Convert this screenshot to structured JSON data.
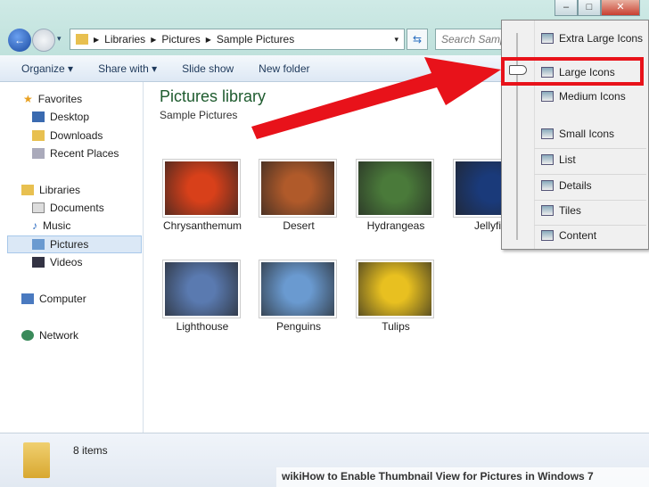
{
  "address": {
    "crumbs": [
      "Libraries",
      "Pictures",
      "Sample Pictures"
    ],
    "search_placeholder": "Search Samp"
  },
  "toolbar": {
    "organize": "Organize ▾",
    "share": "Share with ▾",
    "slideshow": "Slide show",
    "newfolder": "New folder"
  },
  "sidebar": {
    "favorites": "Favorites",
    "desktop": "Desktop",
    "downloads": "Downloads",
    "recent": "Recent Places",
    "libraries": "Libraries",
    "documents": "Documents",
    "music": "Music",
    "pictures": "Pictures",
    "videos": "Videos",
    "computer": "Computer",
    "network": "Network"
  },
  "library": {
    "title": "Pictures library",
    "subtitle": "Sample Pictures"
  },
  "items": [
    {
      "name": "Chrysanthemum",
      "color": "#d8401a"
    },
    {
      "name": "Desert",
      "color": "#b05a2a"
    },
    {
      "name": "Hydrangeas",
      "color": "#4a7a3a"
    },
    {
      "name": "Jellyfish",
      "color": "#1a3a7a"
    },
    {
      "name": "Lighthouse",
      "color": "#5a7ab0"
    },
    {
      "name": "Penguins",
      "color": "#6a9ad0"
    },
    {
      "name": "Tulips",
      "color": "#e8c020"
    }
  ],
  "status": {
    "count": "8 items"
  },
  "view_menu": [
    "Extra Large Icons",
    "Large Icons",
    "Medium Icons",
    "Small Icons",
    "List",
    "Details",
    "Tiles",
    "Content"
  ],
  "watermark": "wikiHow to Enable Thumbnail View for Pictures in Windows 7",
  "accent": "#e8121a"
}
